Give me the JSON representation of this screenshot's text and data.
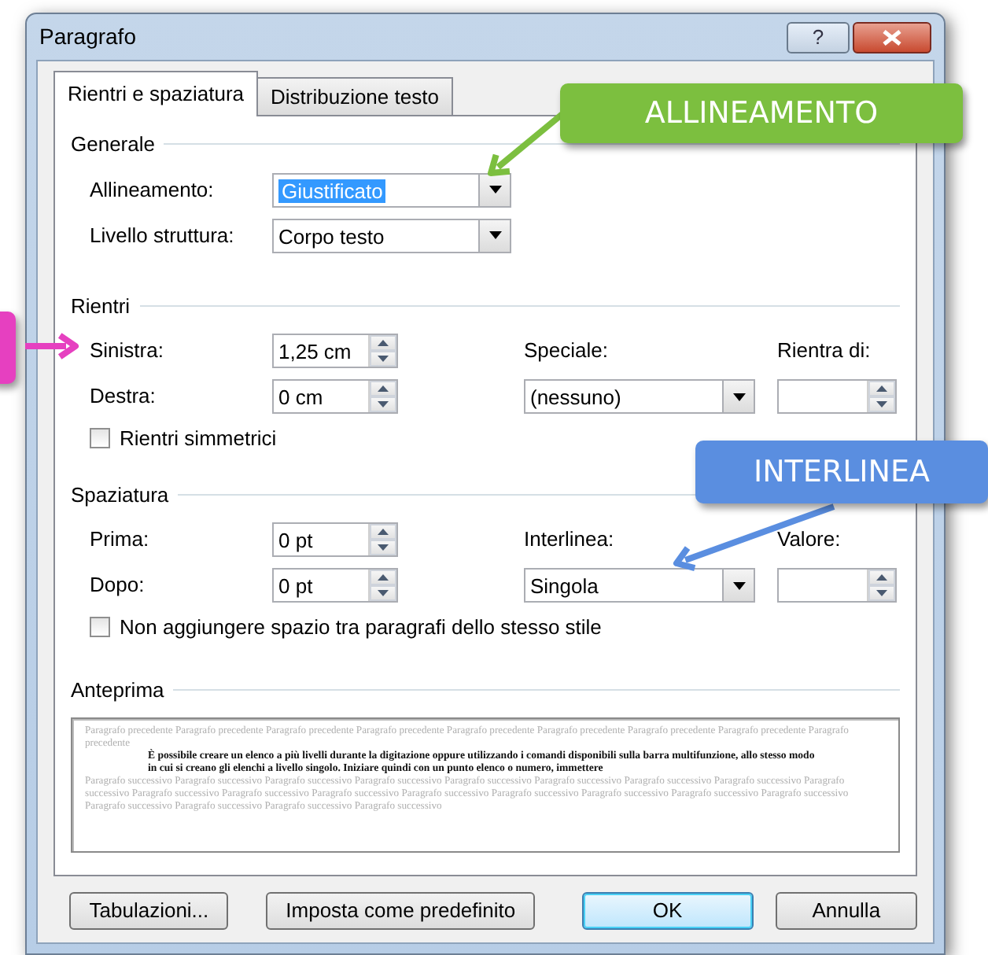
{
  "window": {
    "title": "Paragrafo",
    "help": "?"
  },
  "tabs": [
    {
      "label": "Rientri e spaziatura",
      "selected": true
    },
    {
      "label": "Distribuzione testo",
      "selected": false
    }
  ],
  "generale": {
    "title": "Generale",
    "fields": [
      {
        "label": "Allineamento:",
        "value": "Giustificato",
        "highlighted": true
      },
      {
        "label": "Livello struttura:",
        "value": "Corpo testo",
        "highlighted": false
      }
    ]
  },
  "rientri": {
    "title": "Rientri",
    "left": {
      "label": "Sinistra:",
      "value": "1,25 cm"
    },
    "right": {
      "label": "Destra:",
      "value": "0 cm"
    },
    "special": {
      "label": "Speciale:",
      "value": "(nessuno)"
    },
    "amount": {
      "label": "Rientra di:"
    },
    "checkbox": {
      "label": "Rientri simmetrici",
      "checked": false
    }
  },
  "spaziatura": {
    "title": "Spaziatura",
    "before": {
      "label": "Prima:",
      "value": "0 pt"
    },
    "after": {
      "label": "Dopo:",
      "value": "0 pt"
    },
    "line": {
      "label": "Interlinea:",
      "value": "Singola"
    },
    "amount": {
      "label": "Valore:"
    },
    "checkbox": {
      "label": "Non aggiungere spazio tra paragrafi dello stesso stile",
      "checked": false
    }
  },
  "anteprima": {
    "title": "Anteprima",
    "preceding": "Paragrafo precedente Paragrafo precedente Paragrafo precedente Paragrafo precedente Paragrafo precedente Paragrafo precedente Paragrafo precedente Paragrafo precedente Paragrafo precedente",
    "sample": "È possibile creare un elenco a più livelli durante la digitazione oppure utilizzando i comandi disponibili sulla barra multifunzione, allo stesso modo in cui si creano gli elenchi a livello singolo. Iniziare quindi con un punto elenco o numero, immettere",
    "following": "Paragrafo successivo Paragrafo successivo Paragrafo successivo Paragrafo successivo Paragrafo successivo Paragrafo successivo Paragrafo successivo Paragrafo successivo Paragrafo successivo Paragrafo successivo Paragrafo successivo Paragrafo successivo Paragrafo successivo Paragrafo successivo Paragrafo successivo Paragrafo successivo Paragrafo successivo Paragrafo successivo Paragrafo successivo Paragrafo successivo Paragrafo successivo"
  },
  "buttons": [
    {
      "label": "Tabulazioni...",
      "default": false
    },
    {
      "label": "Imposta come predefinito",
      "default": false
    },
    {
      "label": "OK",
      "default": true
    },
    {
      "label": "Annulla",
      "default": false
    }
  ],
  "callouts": [
    {
      "kind": "label",
      "text": "ALLINEAMENTO",
      "color": "#7cbf3f"
    },
    {
      "kind": "label",
      "text": "INTERLINEA",
      "color": "#5a8ee0"
    },
    {
      "kind": "tag",
      "color": "#e640c0"
    }
  ]
}
